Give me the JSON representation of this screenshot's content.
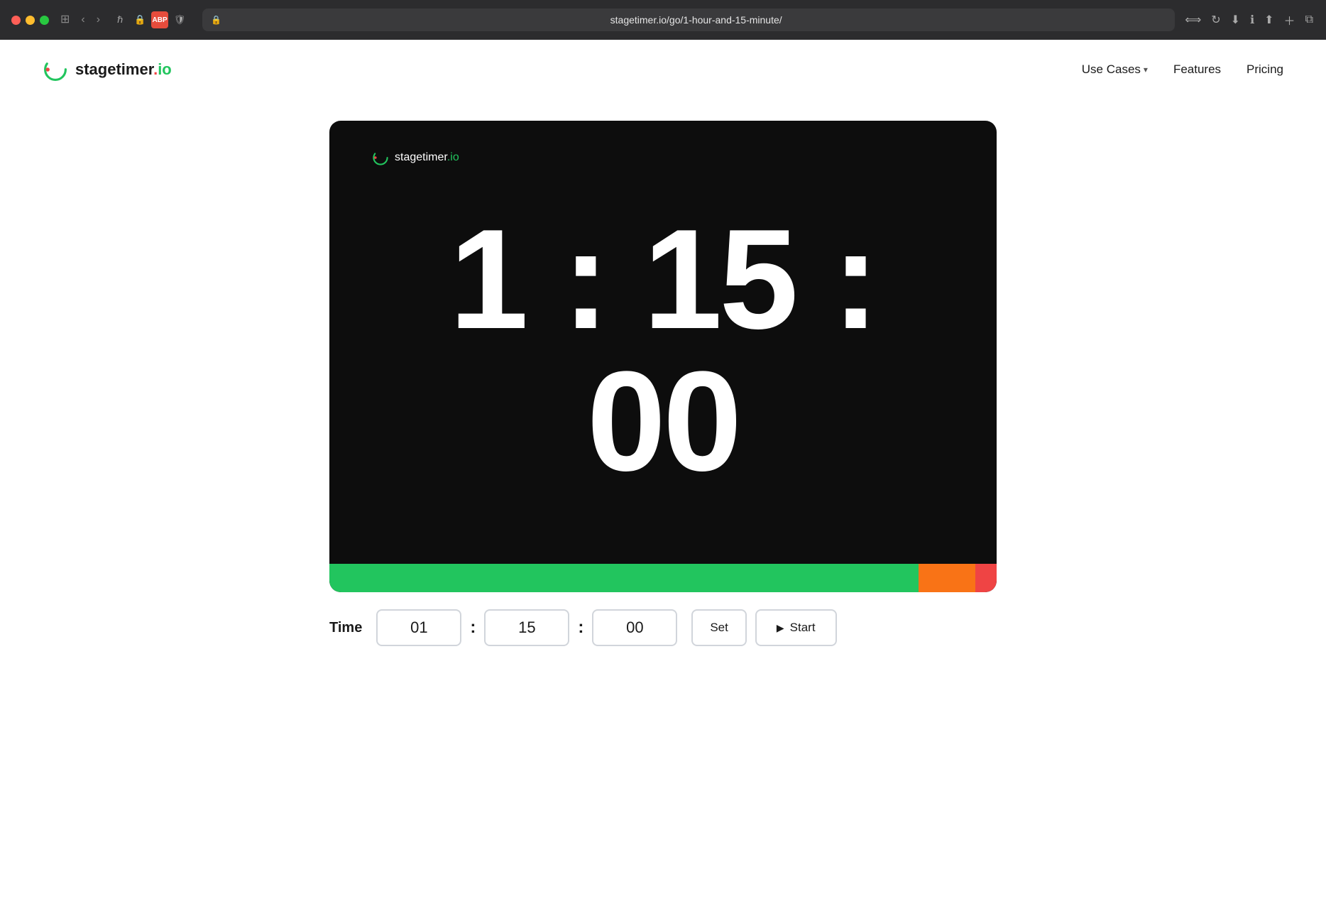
{
  "browser": {
    "url": "stagetimer.io/go/1-hour-and-15-minute/",
    "url_display": "stagetimer.io/go/1-hour-and-15-minute/"
  },
  "nav": {
    "logo_text": "stagetimer",
    "logo_dot": ".",
    "logo_io": "io",
    "links": [
      {
        "label": "Use Cases",
        "dropdown": true
      },
      {
        "label": "Features",
        "dropdown": false
      },
      {
        "label": "Pricing",
        "dropdown": false
      }
    ]
  },
  "timer": {
    "brand_text": "stagetimer",
    "brand_io": ".io",
    "display": "1 : 15 : 00",
    "hours": "01",
    "minutes": "15",
    "seconds": "00",
    "progress": {
      "green_pct": 88,
      "orange_pct": 8,
      "red_pct": 4
    }
  },
  "controls": {
    "time_label": "Time",
    "hours_value": "01",
    "minutes_value": "15",
    "seconds_value": "00",
    "set_label": "Set",
    "start_label": "Start"
  }
}
